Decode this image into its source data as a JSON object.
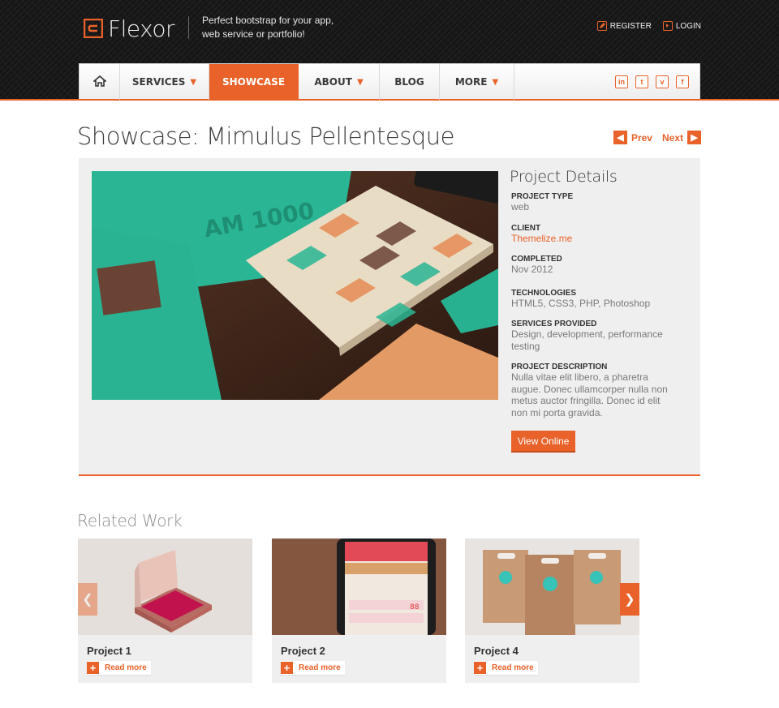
{
  "colors": {
    "accent": "#e8622a",
    "header_bg": "#161616",
    "panel_bg": "#efefef"
  },
  "header": {
    "logo_text": "Flexor",
    "tagline": "Perfect bootstrap for your app, web service or portfolio!",
    "register_label": "REGISTER",
    "login_label": "LOGIN"
  },
  "nav": {
    "items": [
      {
        "label": "SERVICES",
        "dropdown": true
      },
      {
        "label": "SHOWCASE",
        "active": true
      },
      {
        "label": "ABOUT",
        "dropdown": true
      },
      {
        "label": "BLOG"
      },
      {
        "label": "MORE",
        "dropdown": true
      }
    ],
    "social": [
      "in",
      "t",
      "v",
      "f"
    ],
    "icons": {
      "home": "home-icon",
      "social": [
        "linkedin-icon",
        "twitter-icon",
        "vimeo-icon",
        "facebook-icon"
      ]
    }
  },
  "page": {
    "title": "Showcase: Mimulus Pellentesque",
    "prev_label": "Prev",
    "next_label": "Next"
  },
  "project": {
    "heading": "Project Details",
    "fields": [
      {
        "label": "PROJECT TYPE",
        "value": "web"
      },
      {
        "label": "CLIENT",
        "value": "Themelize.me"
      },
      {
        "label": "COMPLETED",
        "value": "Nov 2012"
      },
      {
        "label": "TECHNOLOGIES",
        "value": "HTML5, CSS3, PHP, Photoshop"
      },
      {
        "label": "SERVICES PROVIDED",
        "value": "Design, development, performance testing"
      },
      {
        "label": "PROJECT DESCRIPTION",
        "value": "Nulla vitae elit libero, a pharetra augue. Donec ullamcorper nulla non metus auctor fringilla. Donec id elit non mi porta gravida."
      }
    ],
    "view_button": "View Online",
    "image_text": "AM 1000"
  },
  "related": {
    "title": "Related Work",
    "read_more_label": "Read more",
    "items": [
      {
        "name": "Project 1"
      },
      {
        "name": "Project 2"
      },
      {
        "name": "Project 4"
      }
    ]
  }
}
